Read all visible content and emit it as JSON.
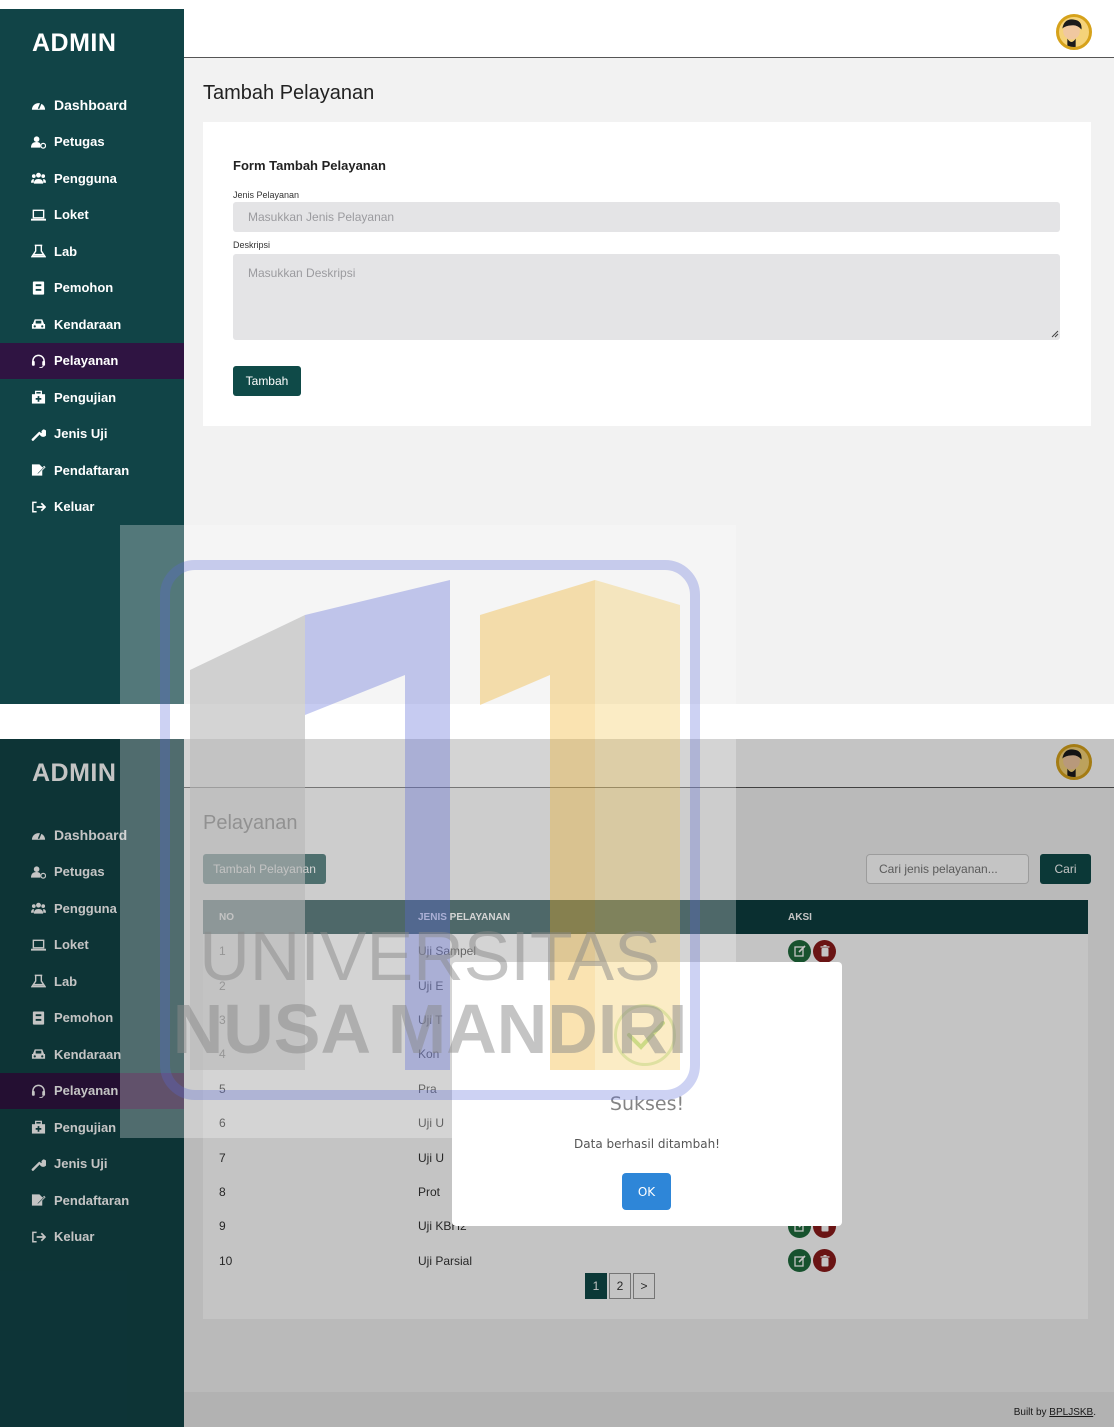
{
  "colors": {
    "sidebar": "#114447",
    "active_nav": "#2f1442",
    "primary": "#0f4a48",
    "table_header": "#0d3e3f",
    "edit": "#1f6b3c",
    "delete": "#8b1a1a",
    "ok_button": "#2e86d8"
  },
  "sidebar": {
    "brand": "ADMIN",
    "items": [
      {
        "label": "Dashboard",
        "icon": "tachometer-icon"
      },
      {
        "label": "Petugas",
        "icon": "user-cog-icon"
      },
      {
        "label": "Pengguna",
        "icon": "users-icon"
      },
      {
        "label": "Loket",
        "icon": "laptop-icon"
      },
      {
        "label": "Lab",
        "icon": "flask-icon"
      },
      {
        "label": "Pemohon",
        "icon": "id-card-icon"
      },
      {
        "label": "Kendaraan",
        "icon": "car-icon"
      },
      {
        "label": "Pelayanan",
        "icon": "headset-icon"
      },
      {
        "label": "Pengujian",
        "icon": "clinic-icon"
      },
      {
        "label": "Jenis Uji",
        "icon": "wrench-icon"
      },
      {
        "label": "Pendaftaran",
        "icon": "signature-icon"
      },
      {
        "label": "Keluar",
        "icon": "sign-out-icon"
      }
    ]
  },
  "screen1": {
    "page_title": "Tambah Pelayanan",
    "form": {
      "title": "Form Tambah Pelayanan",
      "jenis_label": "Jenis Pelayanan",
      "jenis_placeholder": "Masukkan Jenis Pelayanan",
      "deskripsi_label": "Deskripsi",
      "deskripsi_placeholder": "Masukkan Deskripsi",
      "submit": "Tambah"
    }
  },
  "screen2": {
    "page_title": "Pelayanan",
    "add_button": "Tambah Pelayanan",
    "search_placeholder": "Cari jenis pelayanan...",
    "search_button": "Cari",
    "table": {
      "headers": [
        "NO",
        "JENIS PELAYANAN",
        "AKSI"
      ],
      "rows": [
        {
          "no": "1",
          "jenis": "Uji Sampel"
        },
        {
          "no": "2",
          "jenis": "Uji E"
        },
        {
          "no": "3",
          "jenis": "Uji T"
        },
        {
          "no": "4",
          "jenis": "Kon"
        },
        {
          "no": "5",
          "jenis": "Pra"
        },
        {
          "no": "6",
          "jenis": "Uji U"
        },
        {
          "no": "7",
          "jenis": "Uji U"
        },
        {
          "no": "8",
          "jenis": "Prot"
        },
        {
          "no": "9",
          "jenis": "Uji KBH2"
        },
        {
          "no": "10",
          "jenis": "Uji Parsial"
        }
      ]
    },
    "pagination": [
      "1",
      "2",
      ">"
    ],
    "footer_prefix": "Built by ",
    "footer_link": "BPLJSKB",
    "footer_suffix": ".",
    "modal": {
      "title": "Sukses!",
      "message": "Data berhasil ditambah!",
      "ok": "OK"
    }
  },
  "watermark": {
    "line1": "UNIVERSITAS",
    "line2": "NUSA MANDIRI"
  }
}
